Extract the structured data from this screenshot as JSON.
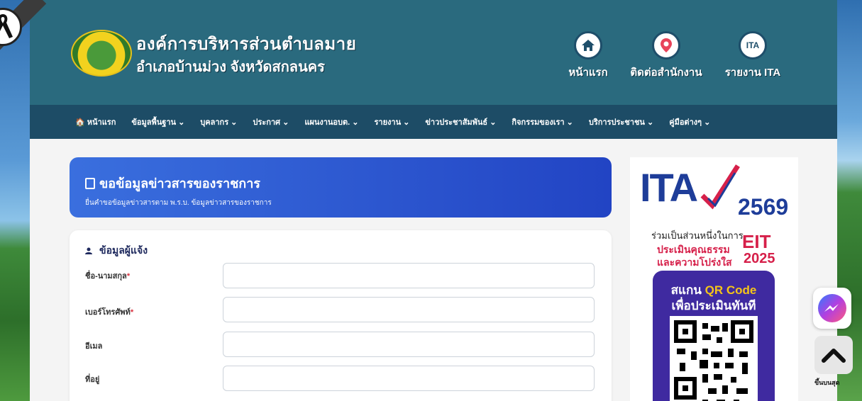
{
  "header": {
    "org_name": "องค์การบริหารส่วนตำบลมาย",
    "org_subtitle": "อำเภอบ้านม่วง จังหวัดสกลนคร",
    "links": [
      {
        "label": "หน้าแรก",
        "icon": "home-icon"
      },
      {
        "label": "ติดต่อสำนักงาน",
        "icon": "location-pin-icon"
      },
      {
        "label": "รายงาน ITA",
        "icon": "ita-icon",
        "icon_text": "ITA"
      }
    ]
  },
  "nav": {
    "items": [
      {
        "label": "🏠 หน้าแรก"
      },
      {
        "label": "ข้อมูลพื้นฐาน ⌄"
      },
      {
        "label": "บุคลากร ⌄"
      },
      {
        "label": "ประกาศ ⌄"
      },
      {
        "label": "แผนงานอบต. ⌄"
      },
      {
        "label": "รายงาน ⌄"
      },
      {
        "label": "ข่าวประชาสัมพันธ์ ⌄"
      },
      {
        "label": "กิจกรรมของเรา ⌄"
      },
      {
        "label": "บริการประชาชน ⌄"
      },
      {
        "label": "คู่มือต่างๆ ⌄"
      }
    ]
  },
  "banner": {
    "title": "ขอข้อมูลข่าวสารของราชการ",
    "subtitle": "ยื่นคำขอข้อมูลข่าวสารตาม พ.ร.บ. ข้อมูลข่าวสารของราชการ"
  },
  "form": {
    "section_title": "ข้อมูลผู้แจ้ง",
    "fields": [
      {
        "label": "ชื่อ-นามสกุล",
        "required": "*",
        "value": ""
      },
      {
        "label": "เบอร์โทรศัพท์",
        "required": "*",
        "value": ""
      },
      {
        "label": "อีเมล",
        "required": "",
        "value": ""
      },
      {
        "label": "ที่อยู่",
        "required": "",
        "value": ""
      }
    ]
  },
  "ad": {
    "ita": "ITA",
    "year": "2569",
    "line1": "ร่วมเป็นส่วนหนึ่งในการ",
    "line2": "ประเมินคุณธรรม",
    "line3": "และความโปร่งใส",
    "eit": "EIT",
    "eit_year": "2025",
    "qr_line1_prefix": "สแกน",
    "qr_line1_highlight": "QR Code",
    "qr_line2": "เพื่อประเมินทันที"
  },
  "floating": {
    "back_to_top": "ขึ้นบนสุด"
  },
  "colors": {
    "header_bg": "#2a6a7e",
    "nav_bg": "#1d4c66",
    "banner_start": "#3a6fde",
    "banner_end": "#2244c4",
    "required": "#d9303e"
  }
}
